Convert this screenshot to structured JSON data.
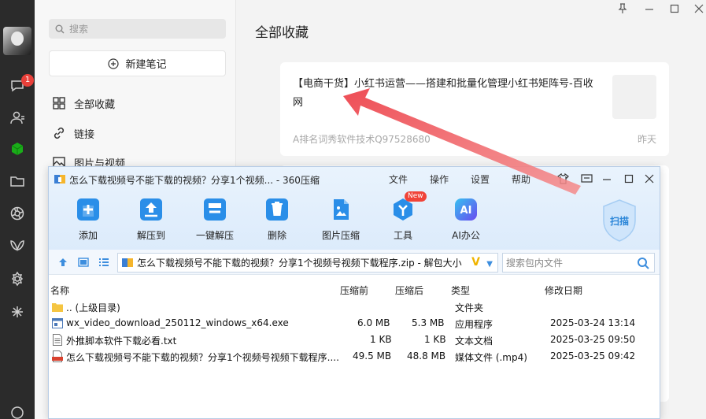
{
  "rail": {
    "badge": "1",
    "icons": [
      "chat-icon",
      "contacts-icon",
      "favorites-cube-icon",
      "folder-icon",
      "moments-icon",
      "channels-icon",
      "miniapp-icon",
      "discover-icon"
    ]
  },
  "sidebar": {
    "search_placeholder": "搜索",
    "new_note": "新建笔记",
    "items": [
      {
        "label": "全部收藏",
        "icon": "grid-icon"
      },
      {
        "label": "链接",
        "icon": "link-icon"
      },
      {
        "label": "图片与视频",
        "icon": "image-icon"
      }
    ]
  },
  "main": {
    "title": "全部收藏",
    "card": {
      "title": "【电商干货】小红书运营——搭建和批量化管理小红书矩阵号-百收网",
      "author": "A排名词秀软件技术Q97528680",
      "time": "昨天"
    }
  },
  "zip": {
    "title": "怎么下载视频号不能下载的视频？分享1个视频... - 360压缩",
    "menu": [
      "文件",
      "操作",
      "设置",
      "帮助"
    ],
    "toolbar": [
      {
        "label": "添加",
        "icon": "add-icon",
        "color": "#2a8ee8"
      },
      {
        "label": "解压到",
        "icon": "extract-to-icon",
        "color": "#2a8ee8"
      },
      {
        "label": "一键解压",
        "icon": "one-click-extract-icon",
        "color": "#2a8ee8"
      },
      {
        "label": "删除",
        "icon": "delete-icon",
        "color": "#2a8ee8"
      },
      {
        "label": "图片压缩",
        "icon": "image-compress-icon",
        "color": "#2a8ee8"
      },
      {
        "label": "工具",
        "icon": "tools-icon",
        "color": "#2a8ee8",
        "badge": "New"
      },
      {
        "label": "AI办公",
        "icon": "ai-office-icon",
        "color": "#4a6cf0"
      }
    ],
    "scan_label": "扫描",
    "path": "怎么下载视频号不能下载的视频？分享1个视频号视频下载程序.zip - 解包大小",
    "search_placeholder": "搜索包内文件",
    "columns": [
      "名称",
      "压缩前",
      "压缩后",
      "类型",
      "修改日期"
    ],
    "files": [
      {
        "name": ".. (上级目录)",
        "before": "",
        "after": "",
        "type": "文件夹",
        "date": "",
        "icon": "folder"
      },
      {
        "name": "wx_video_download_250112_windows_x64.exe",
        "before": "6.0 MB",
        "after": "5.3 MB",
        "type": "应用程序",
        "date": "2025-03-24 13:14",
        "icon": "exe"
      },
      {
        "name": "外推脚本软件下载必看.txt",
        "before": "1 KB",
        "after": "1 KB",
        "type": "文本文档",
        "date": "2025-03-25 09:50",
        "icon": "txt"
      },
      {
        "name": "怎么下载视频号不能下载的视频？分享1个视频号视频下载程序....",
        "before": "49.5 MB",
        "after": "48.8 MB",
        "type": "媒体文件 (.mp4)",
        "date": "2025-03-25 09:42",
        "icon": "mp4"
      }
    ]
  },
  "colors": {
    "accent": "#2a8ee8",
    "arrow": "#f0545c",
    "favorites": "#1aad19"
  }
}
